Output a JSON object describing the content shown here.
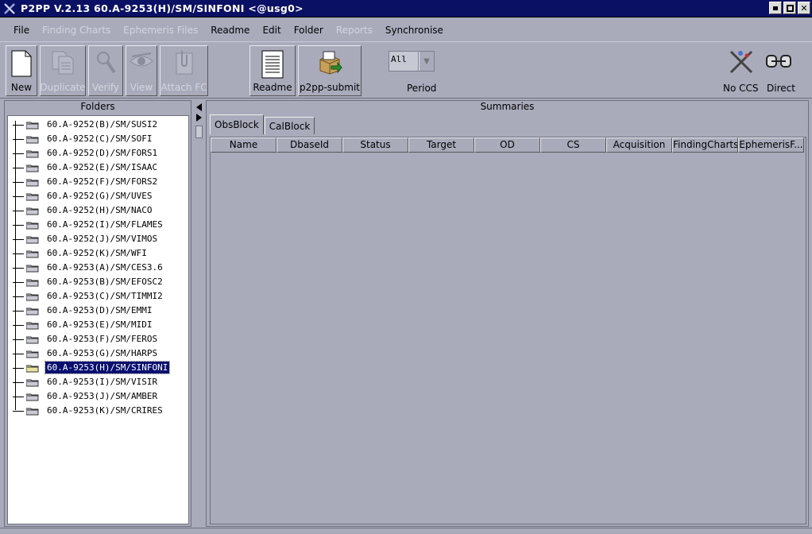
{
  "window": {
    "title": "P2PP V.2.13  60.A-9253(H)/SM/SINFONI <@usg0>",
    "buttons": [
      "minimize",
      "maximize",
      "close"
    ]
  },
  "menu": [
    {
      "label": "File",
      "enabled": true
    },
    {
      "label": "Finding Charts",
      "enabled": false
    },
    {
      "label": "Ephemeris Files",
      "enabled": false
    },
    {
      "label": "Readme",
      "enabled": true
    },
    {
      "label": "Edit",
      "enabled": true
    },
    {
      "label": "Folder",
      "enabled": true
    },
    {
      "label": "Reports",
      "enabled": false
    },
    {
      "label": "Synchronise",
      "enabled": true
    }
  ],
  "toolbar": {
    "new": "New",
    "duplicate": "Duplicate",
    "verify": "Verify",
    "view": "View",
    "attach_fc": "Attach FC",
    "readme": "Readme",
    "submit": "p2pp-submit",
    "period_value": "All",
    "period_label": "Period",
    "no_ccs": "No CCS",
    "direct": "Direct"
  },
  "folders": {
    "header": "Folders",
    "items": [
      "60.A-9252(B)/SM/SUSI2",
      "60.A-9252(C)/SM/SOFI",
      "60.A-9252(D)/SM/FORS1",
      "60.A-9252(E)/SM/ISAAC",
      "60.A-9252(F)/SM/FORS2",
      "60.A-9252(G)/SM/UVES",
      "60.A-9252(H)/SM/NACO",
      "60.A-9252(I)/SM/FLAMES",
      "60.A-9252(J)/SM/VIMOS",
      "60.A-9252(K)/SM/WFI",
      "60.A-9253(A)/SM/CES3.6",
      "60.A-9253(B)/SM/EFOSC2",
      "60.A-9253(C)/SM/TIMMI2",
      "60.A-9253(D)/SM/EMMI",
      "60.A-9253(E)/SM/MIDI",
      "60.A-9253(F)/SM/FEROS",
      "60.A-9253(G)/SM/HARPS",
      "60.A-9253(H)/SM/SINFONI",
      "60.A-9253(I)/SM/VISIR",
      "60.A-9253(J)/SM/AMBER",
      "60.A-9253(K)/SM/CRIRES"
    ],
    "selected": "60.A-9253(H)/SM/SINFONI"
  },
  "summaries": {
    "header": "Summaries",
    "tabs": [
      "ObsBlock",
      "CalBlock"
    ],
    "active_tab": "ObsBlock",
    "columns": [
      "Name",
      "DbaseId",
      "Status",
      "Target",
      "OD",
      "CS",
      "Acquisition",
      "FindingCharts",
      "EphemerisF..."
    ]
  },
  "colors": {
    "background": "#a9abbb",
    "titlebar": "#0a1064",
    "selection": "#0a1070"
  }
}
